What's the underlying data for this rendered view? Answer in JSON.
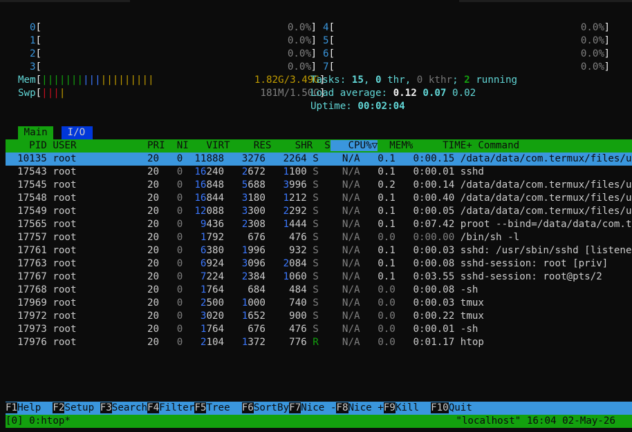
{
  "cpus_left": [
    {
      "id": "0",
      "pct": "0.0%"
    },
    {
      "id": "1",
      "pct": "0.0%"
    },
    {
      "id": "2",
      "pct": "0.0%"
    },
    {
      "id": "3",
      "pct": "0.0%"
    }
  ],
  "cpus_right": [
    {
      "id": "4",
      "pct": "0.0%"
    },
    {
      "id": "5",
      "pct": "0.0%"
    },
    {
      "id": "6",
      "pct": "0.0%"
    },
    {
      "id": "7",
      "pct": "0.0%"
    }
  ],
  "mem": {
    "label": "Mem",
    "value": "1.82G/3.49G",
    "fill": 0.52
  },
  "swp": {
    "label": "Swp",
    "value": "181M/1.50G",
    "fill": 0.12
  },
  "tasks": {
    "label": "Tasks:",
    "count": "15",
    "thr": "0",
    "thr_label": "thr",
    "kthr": "0",
    "kthr_label": "kthr",
    "running": "2",
    "running_label": "running"
  },
  "load": {
    "label": "Load average:",
    "l1": "0.12",
    "l5": "0.07",
    "l15": "0.02"
  },
  "uptime": {
    "label": "Uptime:",
    "value": "00:02:04"
  },
  "tabs": {
    "main": "Main",
    "io": "I/O"
  },
  "columns": [
    "PID",
    "USER",
    "PRI",
    "NI",
    "VIRT",
    "RES",
    "SHR",
    "S",
    "CPU%▽",
    "MEM%",
    "TIME+",
    "Command"
  ],
  "processes": [
    {
      "pid": "10135",
      "user": "root",
      "pri": "20",
      "ni": "0",
      "virt": "11888",
      "res": "3276",
      "shr": "2264",
      "s": "S",
      "cpu": "N/A",
      "mem": "0.1",
      "time": "0:00.15",
      "cmd": "/data/data/com.termux/files/usr",
      "selected": true
    },
    {
      "pid": "17543",
      "user": "root",
      "pri": "20",
      "ni": "0",
      "virt": "16240",
      "res": "2672",
      "shr": "1100",
      "s": "S",
      "cpu": "N/A",
      "mem": "0.1",
      "time": "0:00.01",
      "cmd": "sshd"
    },
    {
      "pid": "17545",
      "user": "root",
      "pri": "20",
      "ni": "0",
      "virt": "16848",
      "res": "5688",
      "shr": "3996",
      "s": "S",
      "cpu": "N/A",
      "mem": "0.2",
      "time": "0:00.14",
      "cmd": "/data/data/com.termux/files/usr"
    },
    {
      "pid": "17548",
      "user": "root",
      "pri": "20",
      "ni": "0",
      "virt": "16844",
      "res": "3180",
      "shr": "1212",
      "s": "S",
      "cpu": "N/A",
      "mem": "0.1",
      "time": "0:00.40",
      "cmd": "/data/data/com.termux/files/usr"
    },
    {
      "pid": "17549",
      "user": "root",
      "pri": "20",
      "ni": "0",
      "virt": "12088",
      "res": "3300",
      "shr": "2292",
      "s": "S",
      "cpu": "N/A",
      "mem": "0.1",
      "time": "0:00.05",
      "cmd": "/data/data/com.termux/files/usr"
    },
    {
      "pid": "17565",
      "user": "root",
      "pri": "20",
      "ni": "0",
      "virt": "9436",
      "res": "2308",
      "shr": "1444",
      "s": "S",
      "cpu": "N/A",
      "mem": "0.1",
      "time": "0:07.42",
      "cmd": "proot --bind=/data/data/com.ter"
    },
    {
      "pid": "17757",
      "user": "root",
      "pri": "20",
      "ni": "0",
      "virt": "1792",
      "res": "676",
      "shr": "476",
      "s": "S",
      "cpu": "N/A",
      "mem": "0.0",
      "time": "0:00.00",
      "cmd": "/bin/sh -l"
    },
    {
      "pid": "17761",
      "user": "root",
      "pri": "20",
      "ni": "0",
      "virt": "6380",
      "res": "1996",
      "shr": "932",
      "s": "S",
      "cpu": "N/A",
      "mem": "0.1",
      "time": "0:00.03",
      "cmd": "sshd: /usr/sbin/sshd [listener]"
    },
    {
      "pid": "17763",
      "user": "root",
      "pri": "20",
      "ni": "0",
      "virt": "6924",
      "res": "3096",
      "shr": "2084",
      "s": "S",
      "cpu": "N/A",
      "mem": "0.1",
      "time": "0:00.08",
      "cmd": "sshd-session: root [priv]"
    },
    {
      "pid": "17767",
      "user": "root",
      "pri": "20",
      "ni": "0",
      "virt": "7224",
      "res": "2384",
      "shr": "1060",
      "s": "S",
      "cpu": "N/A",
      "mem": "0.1",
      "time": "0:03.55",
      "cmd": "sshd-session: root@pts/2"
    },
    {
      "pid": "17768",
      "user": "root",
      "pri": "20",
      "ni": "0",
      "virt": "1764",
      "res": "684",
      "shr": "484",
      "s": "S",
      "cpu": "N/A",
      "mem": "0.0",
      "time": "0:00.08",
      "cmd": "-sh"
    },
    {
      "pid": "17969",
      "user": "root",
      "pri": "20",
      "ni": "0",
      "virt": "2500",
      "res": "1000",
      "shr": "740",
      "s": "S",
      "cpu": "N/A",
      "mem": "0.0",
      "time": "0:00.03",
      "cmd": "tmux"
    },
    {
      "pid": "17972",
      "user": "root",
      "pri": "20",
      "ni": "0",
      "virt": "3020",
      "res": "1652",
      "shr": "900",
      "s": "S",
      "cpu": "N/A",
      "mem": "0.0",
      "time": "0:00.22",
      "cmd": "tmux"
    },
    {
      "pid": "17973",
      "user": "root",
      "pri": "20",
      "ni": "0",
      "virt": "1764",
      "res": "676",
      "shr": "476",
      "s": "S",
      "cpu": "N/A",
      "mem": "0.0",
      "time": "0:00.01",
      "cmd": "-sh"
    },
    {
      "pid": "17976",
      "user": "root",
      "pri": "20",
      "ni": "0",
      "virt": "2104",
      "res": "1372",
      "shr": "776",
      "s": "R",
      "cpu": "N/A",
      "mem": "0.0",
      "time": "0:01.17",
      "cmd": "htop"
    }
  ],
  "fkeys": [
    {
      "key": "F1",
      "label": "Help  "
    },
    {
      "key": "F2",
      "label": "Setup "
    },
    {
      "key": "F3",
      "label": "Search"
    },
    {
      "key": "F4",
      "label": "Filter"
    },
    {
      "key": "F5",
      "label": "Tree  "
    },
    {
      "key": "F6",
      "label": "SortBy"
    },
    {
      "key": "F7",
      "label": "Nice -"
    },
    {
      "key": "F8",
      "label": "Nice +"
    },
    {
      "key": "F9",
      "label": "Kill  "
    },
    {
      "key": "F10",
      "label": "Quit  "
    }
  ],
  "tmux": {
    "window": "[0] 0:htop*",
    "host": "\"localhost\"",
    "time": "16:04",
    "date": "02-May-26"
  },
  "colors": {
    "green": "#13a10e",
    "blue": "#3a96dd",
    "cyan": "#61d6d6",
    "bg": "#0c0c0c"
  }
}
